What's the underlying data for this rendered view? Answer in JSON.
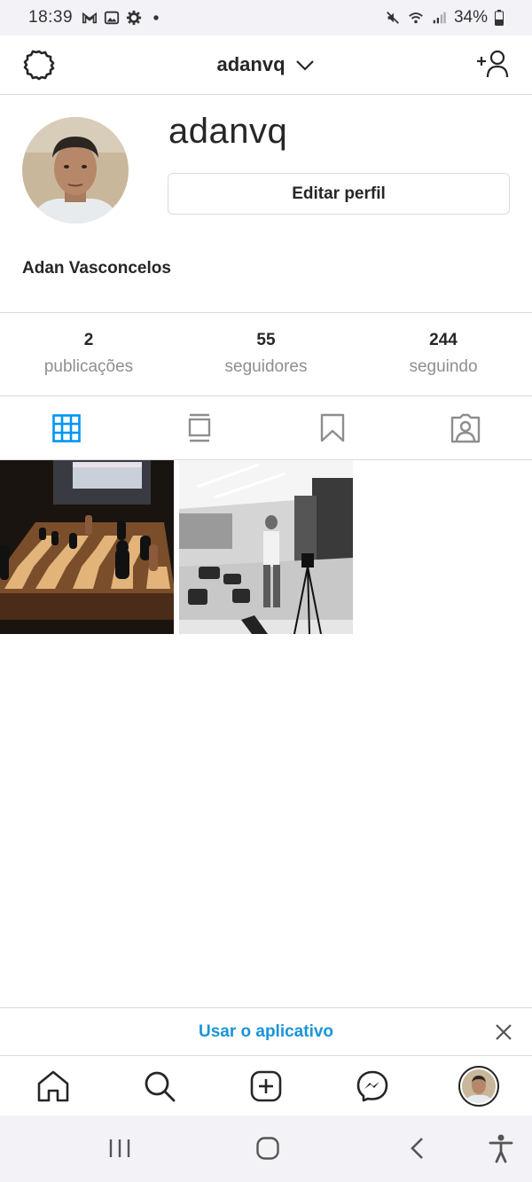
{
  "status_bar": {
    "time": "18:39",
    "battery": "34%",
    "left_icons": [
      "gmail-icon",
      "gallery-icon",
      "settings-icon",
      "dot-icon"
    ],
    "right_icons": [
      "mute-icon",
      "wifi-icon",
      "signal-icon",
      "battery-icon"
    ]
  },
  "header": {
    "username": "adanvq",
    "left_icon": "settings-icon",
    "right_icon": "add-person-icon"
  },
  "profile": {
    "username": "adanvq",
    "edit_button": "Editar perfil",
    "full_name": "Adan Vasconcelos"
  },
  "stats": [
    {
      "value": "2",
      "label": "publicações"
    },
    {
      "value": "55",
      "label": "seguidores"
    },
    {
      "value": "244",
      "label": "seguindo"
    }
  ],
  "tabs": [
    {
      "icon": "grid-icon",
      "active": true
    },
    {
      "icon": "feed-icon",
      "active": false
    },
    {
      "icon": "saved-icon",
      "active": false
    },
    {
      "icon": "tagged-icon",
      "active": false
    }
  ],
  "posts": [
    {
      "subject": "chess-board-photo"
    },
    {
      "subject": "man-in-mall-bw-photo"
    }
  ],
  "banner": {
    "cta": "Usar o aplicativo"
  },
  "bottom_nav": [
    "home-icon",
    "search-icon",
    "new-post-icon",
    "messenger-icon",
    "profile-avatar"
  ],
  "colors": {
    "accent_blue": "#0095f6",
    "link_blue": "#1a94d8",
    "text": "#262626",
    "secondary_text": "#8e8e8e",
    "border": "#dbdbdb"
  }
}
